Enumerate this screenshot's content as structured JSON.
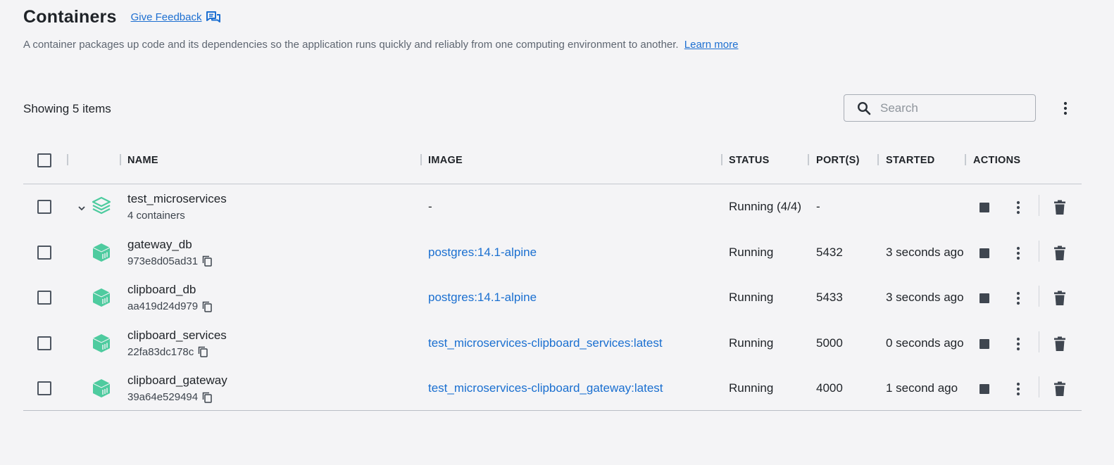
{
  "header": {
    "title": "Containers",
    "feedback_label": "Give Feedback",
    "description": "A container packages up code and its dependencies so the application runs quickly and reliably from one computing environment to another.",
    "learn_more": "Learn more"
  },
  "toolbar": {
    "showing": "Showing 5 items",
    "search_placeholder": "Search"
  },
  "columns": {
    "name": "NAME",
    "image": "IMAGE",
    "status": "STATUS",
    "ports": "PORT(S)",
    "started": "STARTED",
    "actions": "ACTIONS"
  },
  "rows": [
    {
      "name": "test_microservices",
      "sub": "4 containers",
      "image": "-",
      "status": "Running (4/4)",
      "ports": "-",
      "started": ""
    },
    {
      "name": "gateway_db",
      "sub": "973e8d05ad31",
      "image": "postgres:14.1-alpine",
      "status": "Running",
      "ports": "5432",
      "started": "3 seconds ago"
    },
    {
      "name": "clipboard_db",
      "sub": "aa419d24d979",
      "image": "postgres:14.1-alpine",
      "status": "Running",
      "ports": "5433",
      "started": "3 seconds ago"
    },
    {
      "name": "clipboard_services",
      "sub": "22fa83dc178c",
      "image": "test_microservices-clipboard_services:latest",
      "status": "Running",
      "ports": "5000",
      "started": "0 seconds ago"
    },
    {
      "name": "clipboard_gateway",
      "sub": "39a64e529494",
      "image": "test_microservices-clipboard_gateway:latest",
      "status": "Running",
      "ports": "4000",
      "started": "1 second ago"
    }
  ],
  "colors": {
    "accent": "#1d6fd1",
    "container_icon": "#4ecb9f",
    "background": "#f4f4f6"
  }
}
